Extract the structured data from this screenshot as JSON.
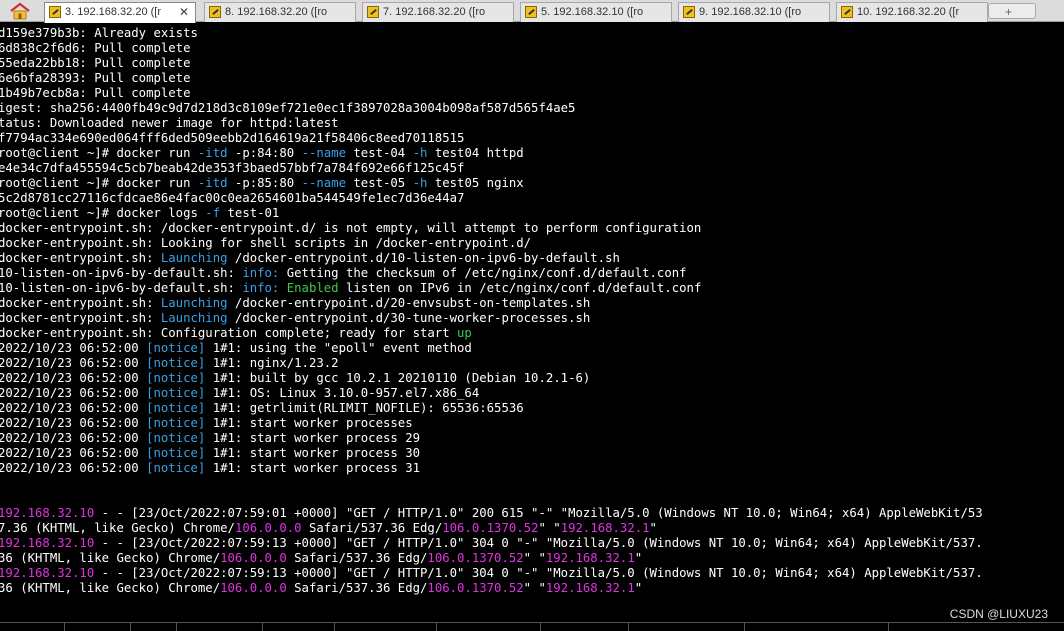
{
  "tabs": [
    {
      "label": "3. 192.168.32.20 ([r",
      "active": true
    },
    {
      "label": "8. 192.168.32.20 ([ro"
    },
    {
      "label": "7. 192.168.32.20 ([ro"
    },
    {
      "label": "5. 192.168.32.10 ([ro"
    },
    {
      "label": "9. 192.168.32.10 ([ro"
    },
    {
      "label": "10. 192.168.32.20 ([r"
    }
  ],
  "active_tab_close": "✕",
  "new_tab_symbol": "+",
  "colors": {
    "default": "#ffffff",
    "cyan": "#3aa0e6",
    "green": "#40c848",
    "magenta": "#e033e0",
    "background": "#000000"
  },
  "terminal_lines": [
    [
      [
        "d159e379b3b: Already exists",
        "d"
      ]
    ],
    [
      [
        "6d838c2f6d6: Pull complete",
        "d"
      ]
    ],
    [
      [
        "55eda22bb18: Pull complete",
        "d"
      ]
    ],
    [
      [
        "6e6bfa28393: Pull complete",
        "d"
      ]
    ],
    [
      [
        "1b49b7ecb8a: Pull complete",
        "d"
      ]
    ],
    [
      [
        "igest: sha256:4400fb49c9d7d218d3c8109ef721e0ec1f3897028a3004b098af587d565f4ae5",
        "d"
      ]
    ],
    [
      [
        "tatus: Downloaded newer image for httpd:latest",
        "d"
      ]
    ],
    [
      [
        "f7794ac334e690ed064fff6ded509eebb2d164619a21f58406c8eed70118515",
        "d"
      ]
    ],
    [
      [
        "root@client ~]# docker run ",
        "d"
      ],
      [
        "-itd",
        "c"
      ],
      [
        " -p:84:80 ",
        "d"
      ],
      [
        "--name",
        "c"
      ],
      [
        " test-04 ",
        "d"
      ],
      [
        "-h",
        "c"
      ],
      [
        " test04 httpd",
        "d"
      ]
    ],
    [
      [
        "e4e34c7dfa455594c5cb7beab42de353f3baed57bbf7a784f692e66f125c45f",
        "d"
      ]
    ],
    [
      [
        "root@client ~]# docker run ",
        "d"
      ],
      [
        "-itd",
        "c"
      ],
      [
        " -p:85:80 ",
        "d"
      ],
      [
        "--name",
        "c"
      ],
      [
        " test-05 ",
        "d"
      ],
      [
        "-h",
        "c"
      ],
      [
        " test05 nginx",
        "d"
      ]
    ],
    [
      [
        "5c2d8781cc27116cfdcae86e4fac00c0ea2654601ba544549fe1ec7d36e44a7",
        "d"
      ]
    ],
    [
      [
        "root@client ~]# docker logs ",
        "d"
      ],
      [
        "-f",
        "c"
      ],
      [
        " test-01",
        "d"
      ]
    ],
    [
      [
        "docker-entrypoint.sh: /docker-entrypoint.d/ is not empty, will attempt to perform configuration",
        "d"
      ]
    ],
    [
      [
        "docker-entrypoint.sh: Looking for shell scripts in /docker-entrypoint.d/",
        "d"
      ]
    ],
    [
      [
        "docker-entrypoint.sh: ",
        "d"
      ],
      [
        "Launching",
        "c"
      ],
      [
        " /docker-entrypoint.d/10-listen-on-ipv6-by-default.sh",
        "d"
      ]
    ],
    [
      [
        "10-listen-on-ipv6-by-default.sh: ",
        "d"
      ],
      [
        "info:",
        "c"
      ],
      [
        " Getting the checksum of /etc/nginx/conf.d/default.conf",
        "d"
      ]
    ],
    [
      [
        "10-listen-on-ipv6-by-default.sh: ",
        "d"
      ],
      [
        "info:",
        "c"
      ],
      [
        " ",
        "d"
      ],
      [
        "Enabled",
        "g"
      ],
      [
        " listen on IPv6 in /etc/nginx/conf.d/default.conf",
        "d"
      ]
    ],
    [
      [
        "docker-entrypoint.sh: ",
        "d"
      ],
      [
        "Launching",
        "c"
      ],
      [
        " /docker-entrypoint.d/20-envsubst-on-templates.sh",
        "d"
      ]
    ],
    [
      [
        "docker-entrypoint.sh: ",
        "d"
      ],
      [
        "Launching",
        "c"
      ],
      [
        " /docker-entrypoint.d/30-tune-worker-processes.sh",
        "d"
      ]
    ],
    [
      [
        "docker-entrypoint.sh: Configuration complete; ready for start ",
        "d"
      ],
      [
        "up",
        "g"
      ]
    ],
    [
      [
        "2022/10/23 06:52:00 ",
        "d"
      ],
      [
        "[notice]",
        "c"
      ],
      [
        " 1#1: using the \"epoll\" event method",
        "d"
      ]
    ],
    [
      [
        "2022/10/23 06:52:00 ",
        "d"
      ],
      [
        "[notice]",
        "c"
      ],
      [
        " 1#1: nginx/1.23.2",
        "d"
      ]
    ],
    [
      [
        "2022/10/23 06:52:00 ",
        "d"
      ],
      [
        "[notice]",
        "c"
      ],
      [
        " 1#1: built by gcc 10.2.1 20210110 (Debian 10.2.1-6)",
        "d"
      ]
    ],
    [
      [
        "2022/10/23 06:52:00 ",
        "d"
      ],
      [
        "[notice]",
        "c"
      ],
      [
        " 1#1: OS: Linux 3.10.0-957.el7.x86_64",
        "d"
      ]
    ],
    [
      [
        "2022/10/23 06:52:00 ",
        "d"
      ],
      [
        "[notice]",
        "c"
      ],
      [
        " 1#1: getrlimit(RLIMIT_NOFILE): 65536:65536",
        "d"
      ]
    ],
    [
      [
        "2022/10/23 06:52:00 ",
        "d"
      ],
      [
        "[notice]",
        "c"
      ],
      [
        " 1#1: start worker processes",
        "d"
      ]
    ],
    [
      [
        "2022/10/23 06:52:00 ",
        "d"
      ],
      [
        "[notice]",
        "c"
      ],
      [
        " 1#1: start worker process 29",
        "d"
      ]
    ],
    [
      [
        "2022/10/23 06:52:00 ",
        "d"
      ],
      [
        "[notice]",
        "c"
      ],
      [
        " 1#1: start worker process 30",
        "d"
      ]
    ],
    [
      [
        "2022/10/23 06:52:00 ",
        "d"
      ],
      [
        "[notice]",
        "c"
      ],
      [
        " 1#1: start worker process 31",
        "d"
      ]
    ],
    [],
    [],
    [
      [
        "192.168.32.10",
        "m"
      ],
      [
        " - - [23/Oct/2022:07:59:01 +0000] \"GET / HTTP/1.0\" 200 615 \"-\" \"Mozilla/5.0 (Windows NT 10.0; Win64; x64) AppleWebKit/53",
        "d"
      ]
    ],
    [
      [
        "7.36 (KHTML, like Gecko) Chrome/",
        "d"
      ],
      [
        "106.0.0.0",
        "m"
      ],
      [
        " Safari/537.36 Edg/",
        "d"
      ],
      [
        "106.0.1370.52",
        "m"
      ],
      [
        "\" \"",
        "d"
      ],
      [
        "192.168.32.1",
        "m"
      ],
      [
        "\"",
        "d"
      ]
    ],
    [
      [
        "192.168.32.10",
        "m"
      ],
      [
        " - - [23/Oct/2022:07:59:13 +0000] \"GET / HTTP/1.0\" 304 0 \"-\" \"Mozilla/5.0 (Windows NT 10.0; Win64; x64) AppleWebKit/537.",
        "d"
      ]
    ],
    [
      [
        "36 (KHTML, like Gecko) Chrome/",
        "d"
      ],
      [
        "106.0.0.0",
        "m"
      ],
      [
        " Safari/537.36 Edg/",
        "d"
      ],
      [
        "106.0.1370.52",
        "m"
      ],
      [
        "\" \"",
        "d"
      ],
      [
        "192.168.32.1",
        "m"
      ],
      [
        "\"",
        "d"
      ]
    ],
    [
      [
        "192.168.32.10",
        "m"
      ],
      [
        " - - [23/Oct/2022:07:59:13 +0000] \"GET / HTTP/1.0\" 304 0 \"-\" \"Mozilla/5.0 (Windows NT 10.0; Win64; x64) AppleWebKit/537.",
        "d"
      ]
    ],
    [
      [
        "36 (KHTML, like Gecko) Chrome/",
        "d"
      ],
      [
        "106.0.0.0",
        "m"
      ],
      [
        " Safari/537.36 Edg/",
        "d"
      ],
      [
        "106.0.1370.52",
        "m"
      ],
      [
        "\" \"",
        "d"
      ],
      [
        "192.168.32.1",
        "m"
      ],
      [
        "\"",
        "d"
      ]
    ]
  ],
  "watermark": "CSDN @LIUXU23"
}
